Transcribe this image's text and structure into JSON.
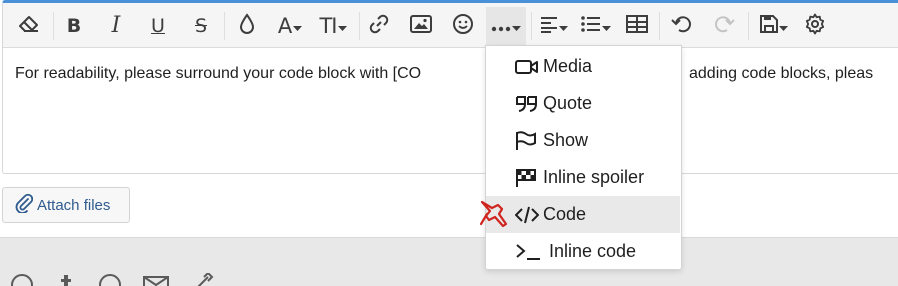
{
  "toolbar": {
    "buttons": [
      {
        "name": "remove-formatting",
        "icon": "eraser-icon"
      },
      {
        "name": "bold",
        "label": "B",
        "icon": "bold-icon"
      },
      {
        "name": "italic",
        "label": "I",
        "icon": "italic-icon"
      },
      {
        "name": "underline",
        "label": "U",
        "icon": "underline-icon"
      },
      {
        "name": "strikethrough",
        "label": "S",
        "icon": "strikethrough-icon"
      },
      {
        "name": "text-color",
        "icon": "droplet-icon"
      },
      {
        "name": "font-family",
        "label": "A",
        "icon": "font-icon"
      },
      {
        "name": "font-size",
        "label": "TI",
        "icon": "text-height-icon"
      },
      {
        "name": "insert-link",
        "icon": "link-icon"
      },
      {
        "name": "insert-image",
        "icon": "image-icon"
      },
      {
        "name": "smilies",
        "icon": "smile-icon"
      },
      {
        "name": "more-options",
        "label": "···",
        "icon": "ellipsis-icon",
        "active": true
      },
      {
        "name": "align",
        "icon": "align-left-icon"
      },
      {
        "name": "list",
        "icon": "list-icon"
      },
      {
        "name": "table",
        "icon": "table-icon"
      },
      {
        "name": "undo",
        "icon": "undo-icon"
      },
      {
        "name": "redo",
        "icon": "redo-icon",
        "disabled": true
      },
      {
        "name": "drafts",
        "icon": "save-icon"
      },
      {
        "name": "settings",
        "icon": "gear-icon"
      }
    ]
  },
  "editor": {
    "content_text": "For readability, please surround your code block with [CO",
    "content_text_right": "adding code blocks, pleas"
  },
  "attach": {
    "label": "Attach files",
    "icon": "paperclip-icon"
  },
  "menu": {
    "items": [
      {
        "label": "Media",
        "icon": "video-icon"
      },
      {
        "label": "Quote",
        "icon": "quote-icon"
      },
      {
        "label": "Show",
        "icon": "flag-icon"
      },
      {
        "label": "Inline spoiler",
        "icon": "checkered-flag-icon"
      },
      {
        "label": "Code",
        "icon": "code-icon",
        "highlighted": true
      },
      {
        "label": "Inline code",
        "icon": "terminal-icon"
      }
    ]
  },
  "colors": {
    "accent": "#4a90d9",
    "toolbar_bg": "#f5f5f5",
    "icon": "#3d3d3d",
    "link": "#2f5b8f",
    "pin": "#d0241f",
    "band": "#e8e8e8"
  }
}
